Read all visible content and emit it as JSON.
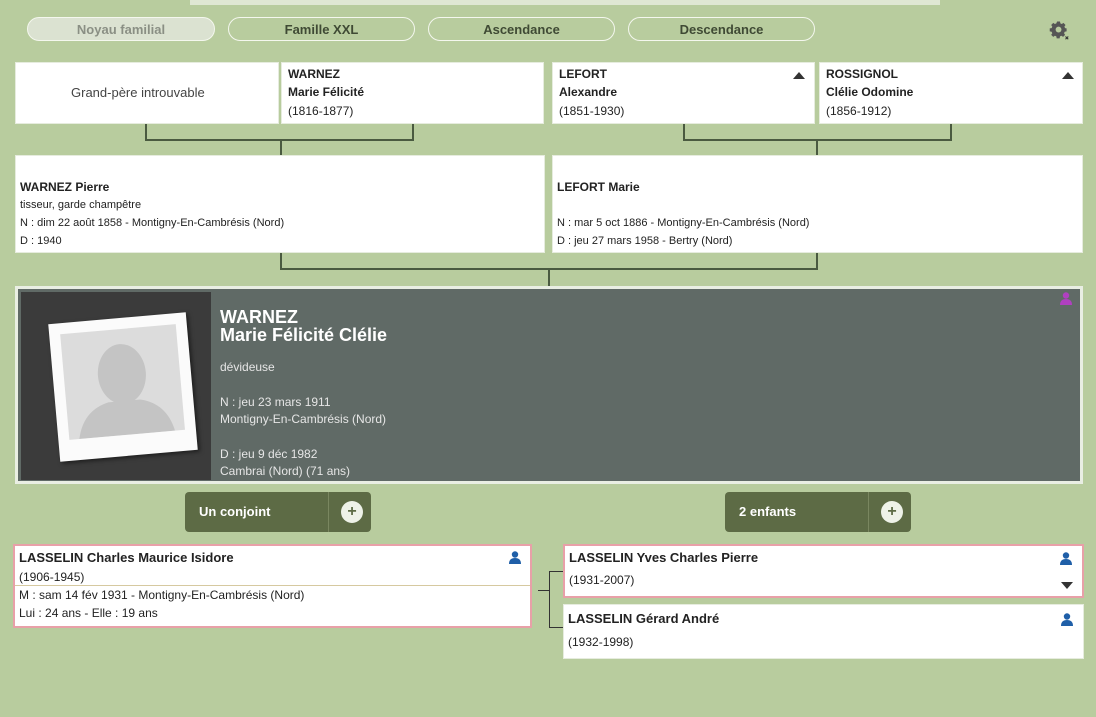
{
  "tabs": [
    {
      "label": "Noyau familial",
      "active": true
    },
    {
      "label": "Famille XXL",
      "active": false
    },
    {
      "label": "Ascendance",
      "active": false
    },
    {
      "label": "Descendance",
      "active": false
    }
  ],
  "grandparents": {
    "unknown_label": "Grand-père introuvable",
    "gp2": {
      "surname": "WARNEZ",
      "given": "Marie Félicité",
      "dates": "(1816-1877)"
    },
    "gp3": {
      "surname": "LEFORT",
      "given": "Alexandre",
      "dates": "(1851-1930)"
    },
    "gp4": {
      "surname": "ROSSIGNOL",
      "given": "Clélie Odomine",
      "dates": "(1856-1912)"
    }
  },
  "parents": {
    "father": {
      "name": "WARNEZ Pierre",
      "occupation": "tisseur, garde champêtre",
      "birth": "N : dim 22 août 1858 - Montigny-En-Cambrésis (Nord)",
      "death": "D : 1940"
    },
    "mother": {
      "name": "LEFORT Marie",
      "birth": "N : mar 5 oct 1886 - Montigny-En-Cambrésis (Nord)",
      "death": "D : jeu 27 mars 1958 - Bertry (Nord)"
    }
  },
  "main": {
    "surname": "WARNEZ",
    "given": "Marie Félicité Clélie",
    "occupation": "dévideuse",
    "birth_date": "N : jeu 23 mars 1911",
    "birth_place": "Montigny-En-Cambrésis (Nord)",
    "death_date": "D : jeu 9 déc 1982",
    "death_place": "Cambrai (Nord) (71 ans)"
  },
  "actions": {
    "spouse_label": "Un conjoint",
    "children_label": "2 enfants",
    "plus": "+"
  },
  "spouse": {
    "name": "LASSELIN Charles Maurice Isidore",
    "dates": "(1906-1945)",
    "marriage": "M : sam 14 fév 1931 - Montigny-En-Cambrésis (Nord)",
    "ages": "Lui : 24 ans - Elle : 19 ans"
  },
  "children": [
    {
      "name": "LASSELIN Yves Charles Pierre",
      "dates": "(1931-2007)"
    },
    {
      "name": "LASSELIN Gérard André",
      "dates": "(1932-1998)"
    }
  ],
  "colors": {
    "background": "#b8cc9e",
    "main_panel": "#606a66",
    "highlight_border": "#e8a0a8",
    "button": "#5d6b45",
    "person_icon": "#1f5fa8"
  }
}
